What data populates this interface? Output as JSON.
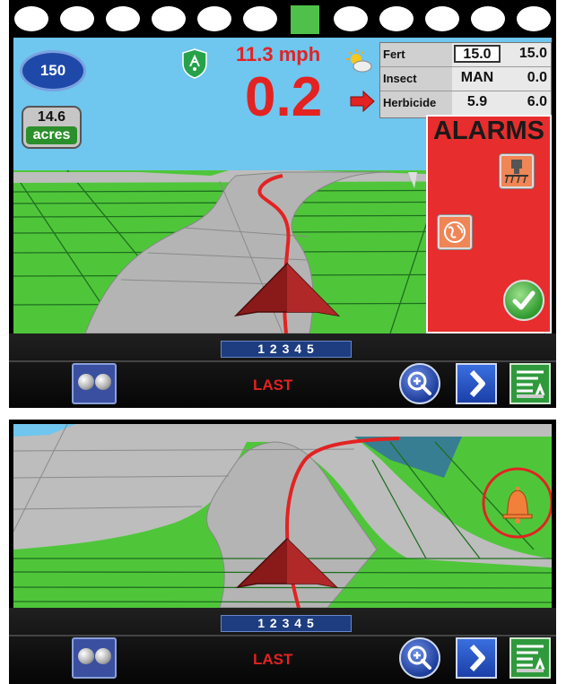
{
  "colors": {
    "sky": "#6fc6ee",
    "field_green": "#4fc63a",
    "path_gray": "#b4b4b4",
    "guide_line": "#e32222",
    "speed_text": "#e32222",
    "alarm_panel": "#e72d2d",
    "toolbar": "#0a0a0a"
  },
  "top_screen": {
    "status_bar": {
      "indicator_count": 12,
      "active_indicator_index": 6
    },
    "speed_badge": "150",
    "area": {
      "value": "14.6",
      "unit_label": "acres"
    },
    "speed": "11.3 mph",
    "offline_distance": "0.2",
    "rates_table": [
      {
        "name": "Fert",
        "target": "15.0",
        "actual": "15.0",
        "target_editable": true
      },
      {
        "name": "Insect",
        "target": "MAN",
        "actual": "0.0",
        "target_editable": false
      },
      {
        "name": "Herbicide",
        "target": "5.9",
        "actual": "6.0",
        "target_editable": false
      }
    ],
    "alarms": {
      "title": "ALARMS",
      "icons": [
        "planter-alarm-icon",
        "gps-globe-alarm-icon",
        "acknowledge-check-icon"
      ]
    },
    "icons": [
      "rtk-shield-icon",
      "weather-sun-cloud-icon",
      "direction-arrow-icon"
    ]
  },
  "bottom_screen": {
    "alarm_indicator": "bell-icon",
    "highlight": "red-circle"
  },
  "toolbar": {
    "page_indicator": "1 2 3 4 5",
    "last_label": "LAST",
    "buttons": [
      "dual-view-button",
      "zoom-button",
      "next-button",
      "list-button"
    ]
  }
}
